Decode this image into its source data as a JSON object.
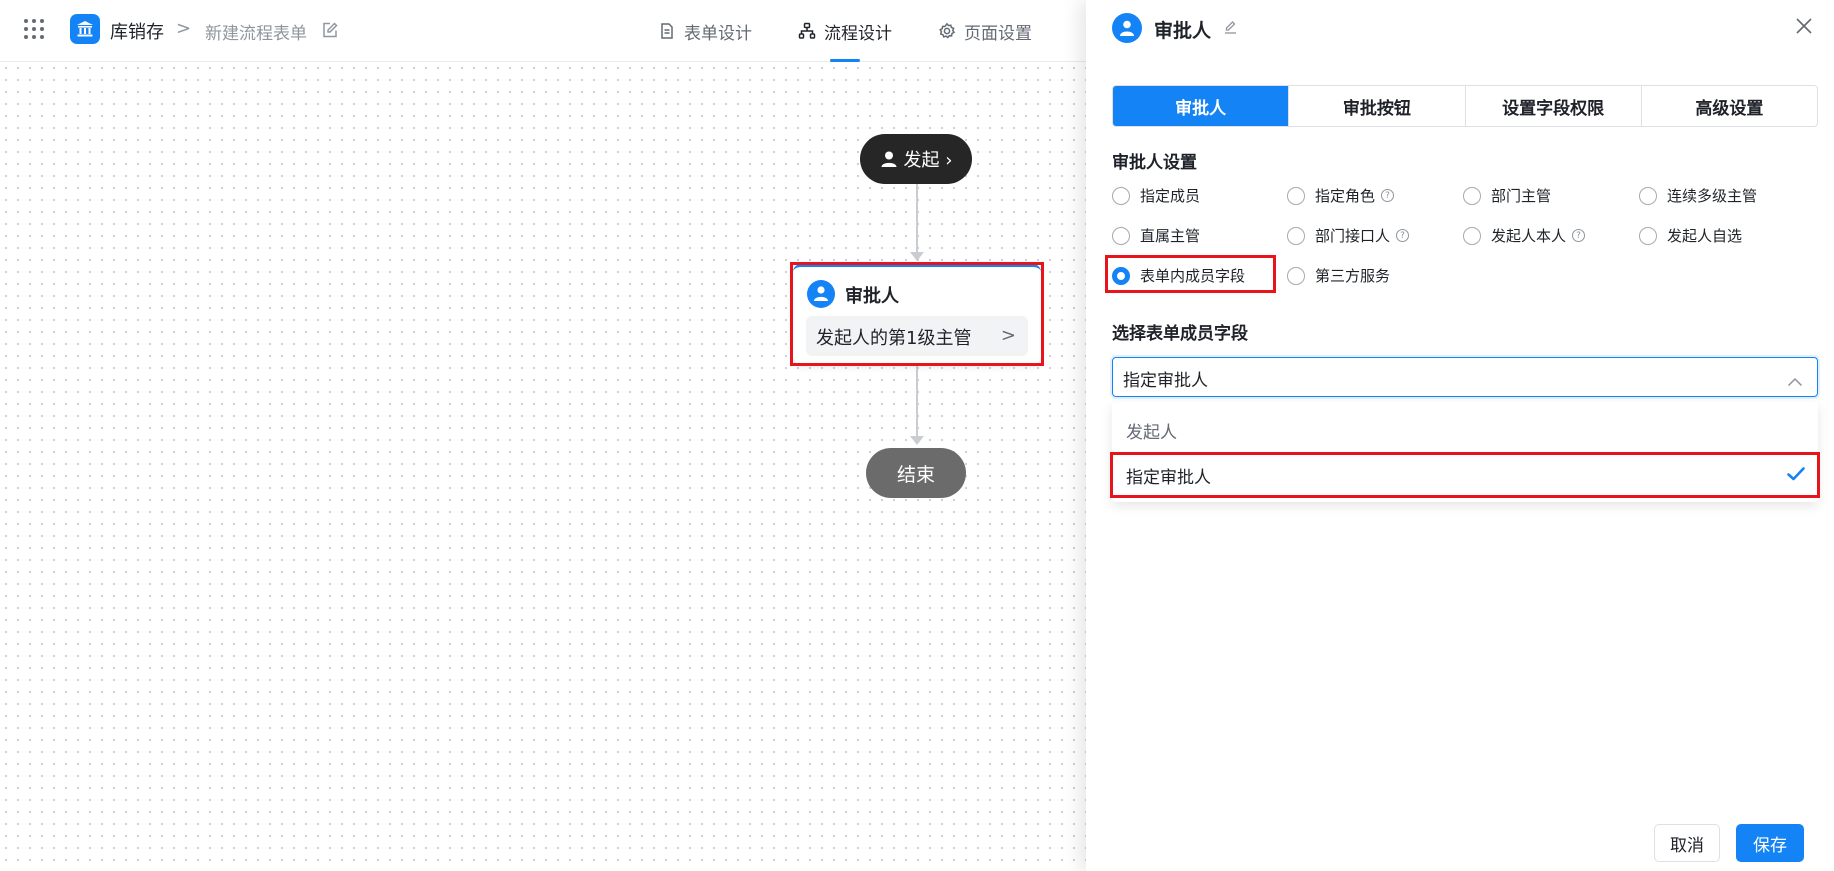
{
  "header": {
    "app_name": "库销存",
    "breadcrumb_sep": ">",
    "form_name": "新建流程表单",
    "tabs": [
      {
        "label": "表单设计",
        "icon": "document-icon"
      },
      {
        "label": "流程设计",
        "icon": "flow-icon",
        "active": true
      },
      {
        "label": "页面设置",
        "icon": "gear-icon"
      }
    ]
  },
  "canvas": {
    "start_node": {
      "label": "发起 ›"
    },
    "approver_node": {
      "title": "审批人",
      "summary": "发起人的第1级主管",
      "chevron": ">"
    },
    "end_node": {
      "label": "结束"
    }
  },
  "panel": {
    "title": "审批人",
    "segments": [
      {
        "label": "审批人",
        "active": true
      },
      {
        "label": "审批按钮"
      },
      {
        "label": "设置字段权限"
      },
      {
        "label": "高级设置"
      }
    ],
    "settings_title": "审批人设置",
    "radio_options": [
      {
        "label": "指定成员"
      },
      {
        "label": "指定角色",
        "help": "?"
      },
      {
        "label": "部门主管"
      },
      {
        "label": "连续多级主管"
      },
      {
        "label": "直属主管"
      },
      {
        "label": "部门接口人",
        "help": "?"
      },
      {
        "label": "发起人本人",
        "help": "?"
      },
      {
        "label": "发起人自选"
      },
      {
        "label": "表单内成员字段",
        "checked": true
      },
      {
        "label": "第三方服务"
      }
    ],
    "field_title": "选择表单成员字段",
    "field_select": {
      "value": "指定审批人"
    },
    "field_options": [
      {
        "label": "发起人",
        "selected": false
      },
      {
        "label": "指定审批人",
        "selected": true
      }
    ],
    "cancel_label": "取消",
    "save_label": "保存"
  },
  "colors": {
    "accent": "#1483f6",
    "highlight": "#e8141c"
  }
}
